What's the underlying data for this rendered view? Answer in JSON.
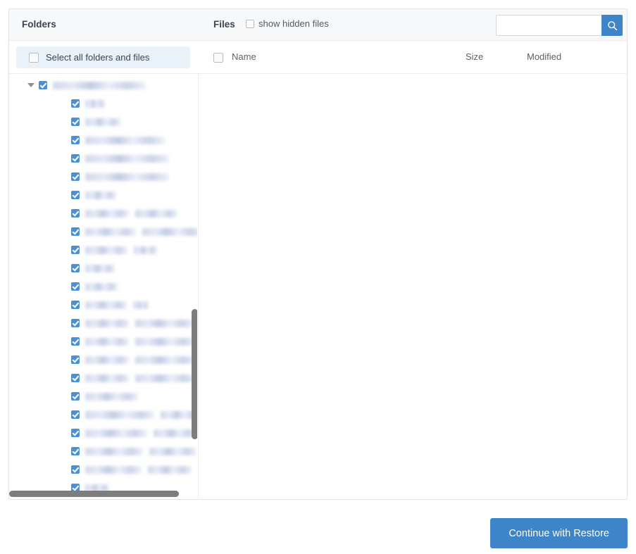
{
  "toolbar": {
    "folders_label": "Folders",
    "files_label": "Files",
    "show_hidden_label": "show hidden files",
    "show_hidden_checked": false,
    "search_value": "",
    "search_placeholder": "",
    "search_icon": "search-icon"
  },
  "columns": {
    "select_all_label": "Select all folders and files",
    "select_all_checked": false,
    "files_select_all_checked": false,
    "name": "Name",
    "size": "Size",
    "modified": "Modified"
  },
  "tree": {
    "root_expanded": true,
    "rows": [
      {
        "depth": 0,
        "checked": true,
        "twisty": true,
        "bars": [
          132
        ]
      },
      {
        "depth": 1,
        "checked": true,
        "twisty": false,
        "bars": [
          28
        ]
      },
      {
        "depth": 1,
        "checked": true,
        "twisty": false,
        "bars": [
          50
        ]
      },
      {
        "depth": 1,
        "checked": true,
        "twisty": false,
        "bars": [
          113
        ]
      },
      {
        "depth": 1,
        "checked": true,
        "twisty": false,
        "bars": [
          119
        ]
      },
      {
        "depth": 1,
        "checked": true,
        "twisty": false,
        "bars": [
          119
        ]
      },
      {
        "depth": 1,
        "checked": true,
        "twisty": false,
        "bars": [
          44
        ]
      },
      {
        "depth": 1,
        "checked": true,
        "twisty": false,
        "bars": [
          62,
          60
        ]
      },
      {
        "depth": 1,
        "checked": true,
        "twisty": false,
        "bars": [
          72,
          85
        ]
      },
      {
        "depth": 1,
        "checked": true,
        "twisty": false,
        "bars": [
          60,
          33
        ]
      },
      {
        "depth": 1,
        "checked": true,
        "twisty": false,
        "bars": [
          42
        ]
      },
      {
        "depth": 1,
        "checked": true,
        "twisty": false,
        "bars": [
          46
        ]
      },
      {
        "depth": 1,
        "checked": true,
        "twisty": false,
        "bars": [
          59,
          22
        ]
      },
      {
        "depth": 1,
        "checked": true,
        "twisty": false,
        "bars": [
          62,
          83
        ]
      },
      {
        "depth": 1,
        "checked": true,
        "twisty": false,
        "bars": [
          62,
          85
        ]
      },
      {
        "depth": 1,
        "checked": true,
        "twisty": false,
        "bars": [
          62,
          86
        ]
      },
      {
        "depth": 1,
        "checked": true,
        "twisty": false,
        "bars": [
          62,
          86
        ]
      },
      {
        "depth": 1,
        "checked": true,
        "twisty": false,
        "bars": [
          75
        ]
      },
      {
        "depth": 1,
        "checked": true,
        "twisty": false,
        "bars": [
          98,
          56
        ]
      },
      {
        "depth": 1,
        "checked": true,
        "twisty": false,
        "bars": [
          88,
          61
        ]
      },
      {
        "depth": 1,
        "checked": true,
        "twisty": false,
        "bars": [
          82,
          67
        ]
      },
      {
        "depth": 1,
        "checked": true,
        "twisty": false,
        "bars": [
          80,
          62
        ]
      },
      {
        "depth": 1,
        "checked": true,
        "twisty": false,
        "bars": [
          34
        ]
      }
    ],
    "vscroll_visible": true,
    "hscroll_visible": true
  },
  "files": {
    "rows": []
  },
  "footer": {
    "continue_label": "Continue with Restore"
  },
  "colors": {
    "accent": "#3d85c8",
    "checkbox_checked": "#4a90d9",
    "select_all_pill": "#e9f1f9",
    "header_bg": "#f7f8f9",
    "scrollbar": "#7d7d7d",
    "border": "#e2e4e8"
  }
}
